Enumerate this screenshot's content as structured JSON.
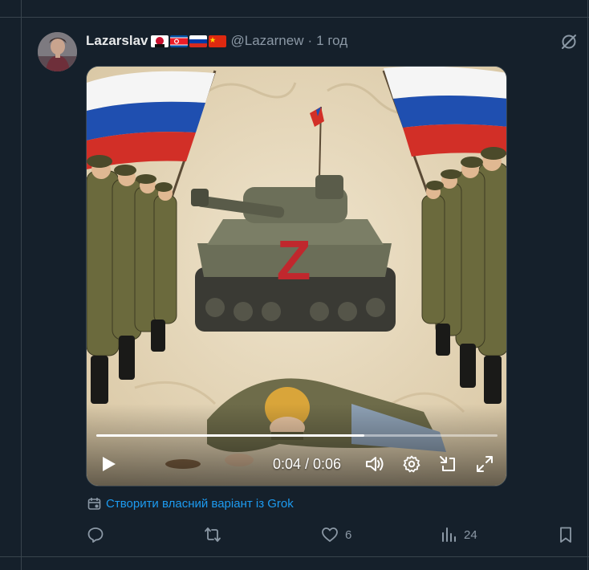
{
  "tweet": {
    "author_name": "Lazarslav",
    "flags": [
      "kangxi-icon",
      "north-korea-flag",
      "russia-flag",
      "china-flag"
    ],
    "handle": "@Lazarnew",
    "separator": "·",
    "time": "1 год"
  },
  "video": {
    "timecode": "0:04 / 0:06",
    "progress": 0.667,
    "scene_letter": "Z"
  },
  "grok_action": {
    "label": "Створити власний варіант із Grok"
  },
  "actions": {
    "reply_count": "",
    "repost_count": "",
    "like_count": "6",
    "views_count": "24"
  },
  "colors": {
    "background": "#15202b",
    "link": "#1d9bf0",
    "muted": "#8b98a5",
    "text": "#e7e9ea"
  }
}
